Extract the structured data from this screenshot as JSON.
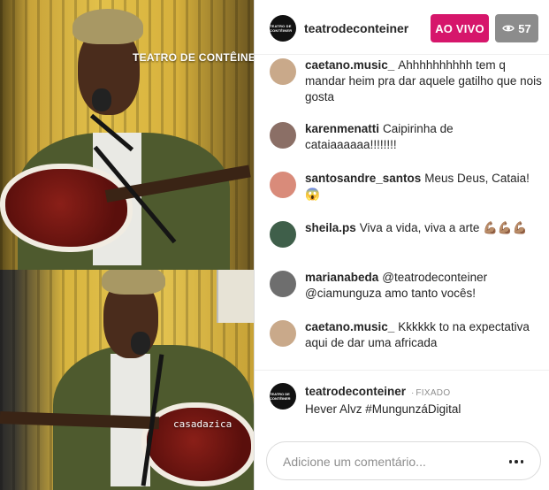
{
  "video": {
    "watermark_top": "TEATRO DE CONTÊINER",
    "watermark_bottom": "casadazica"
  },
  "header": {
    "username": "teatrodeconteiner",
    "avatar_logo_text": "TEATRO DE CONTÊINER",
    "live_label": "AO VIVO",
    "live_color": "#d6166b",
    "viewer_count": "57",
    "viewer_icon": "eye-icon"
  },
  "comments": [
    {
      "user": "caetano.music_",
      "text": "Ahhhhhhhhhh tem q mandar heim pra dar aquele gatilho que nois gosta",
      "avatar_color": "#c9a98a"
    },
    {
      "user": "karenmenatti",
      "text": "Caipirinha de cataiaaaaaa!!!!!!!!",
      "avatar_color": "#8b6f66"
    },
    {
      "user": "santosandre_santos",
      "text": "Meus Deus, Cataia! 😱",
      "avatar_color": "#d98b7a"
    },
    {
      "user": "sheila.ps",
      "text": "Viva a vida, viva a arte 💪🏽💪🏽💪🏽",
      "avatar_color": "#3f5f4a"
    },
    {
      "user": "marianabeda",
      "text": "@teatrodeconteiner @ciamunguza amo tanto vocês!",
      "avatar_color": "#6e6e6e"
    },
    {
      "user": "caetano.music_",
      "text": "Kkkkkk to na expectativa aqui de dar uma africada",
      "avatar_color": "#c9a98a"
    }
  ],
  "pinned": {
    "user": "teatrodeconteiner",
    "label": "FIXADO",
    "text": "Hever Alvz #MungunzáDigital"
  },
  "input": {
    "placeholder": "Adicione um comentário...",
    "value": ""
  }
}
